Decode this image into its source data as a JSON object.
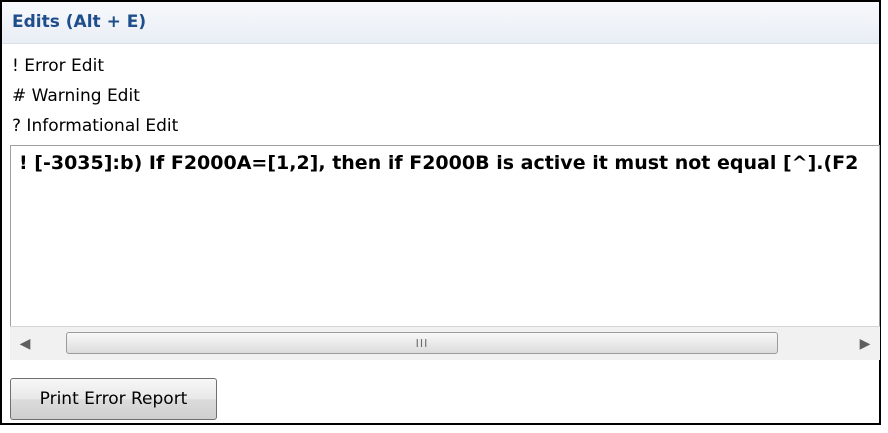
{
  "panel": {
    "title": "Edits (Alt + E)"
  },
  "legend": {
    "items": [
      "! Error Edit",
      "# Warning Edit",
      "? Informational Edit"
    ]
  },
  "edits_list": {
    "rows": [
      "! [-3035]:b) If F2000A=[1,2], then if F2000B is active it must not equal [^].(F2"
    ]
  },
  "scrollbar": {
    "grip_glyph": "III",
    "left_arrow": "◀",
    "right_arrow": "▶"
  },
  "footer": {
    "print_button_label": "Print Error Report"
  }
}
